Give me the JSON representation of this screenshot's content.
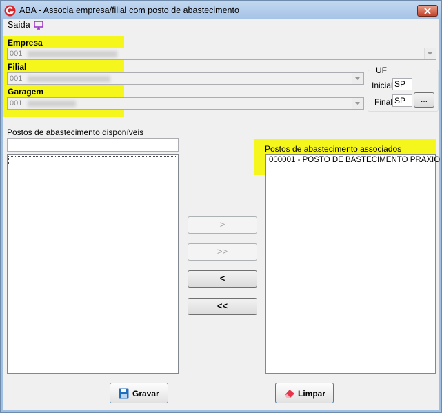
{
  "window": {
    "title": "ABA - Associa empresa/filial com posto de abastecimento"
  },
  "menu": {
    "saida_label": "Saída"
  },
  "empresa": {
    "label": "Empresa",
    "code": "001"
  },
  "filial": {
    "label": "Filial",
    "code": "001"
  },
  "garagem": {
    "label": "Garagem",
    "code": "001"
  },
  "uf": {
    "legend": "UF",
    "inicial_label": "Inicial",
    "inicial_value": "SP",
    "final_label": "Final",
    "final_value": "SP",
    "lookup_label": "..."
  },
  "disponiveis": {
    "label": "Postos de abastecimento disponíveis",
    "filter_value": ""
  },
  "associados": {
    "label": "Postos de abastecimento associados",
    "items": [
      "000001 - POSTO DE BASTECIMENTO PRAXIO"
    ]
  },
  "move_buttons": {
    "add_one": ">",
    "add_all": ">>",
    "remove_one": "<",
    "remove_all": "<<"
  },
  "actions": {
    "gravar": "Gravar",
    "limpar": "Limpar"
  },
  "colors": {
    "highlight": "#f5f61c",
    "title_bar": "#a4c2e6",
    "close_button": "#c5432b"
  },
  "icons": {
    "app": "app-logo-icon",
    "screen": "monitor-icon",
    "save": "floppy-disk-icon",
    "clear": "eraser-icon"
  }
}
